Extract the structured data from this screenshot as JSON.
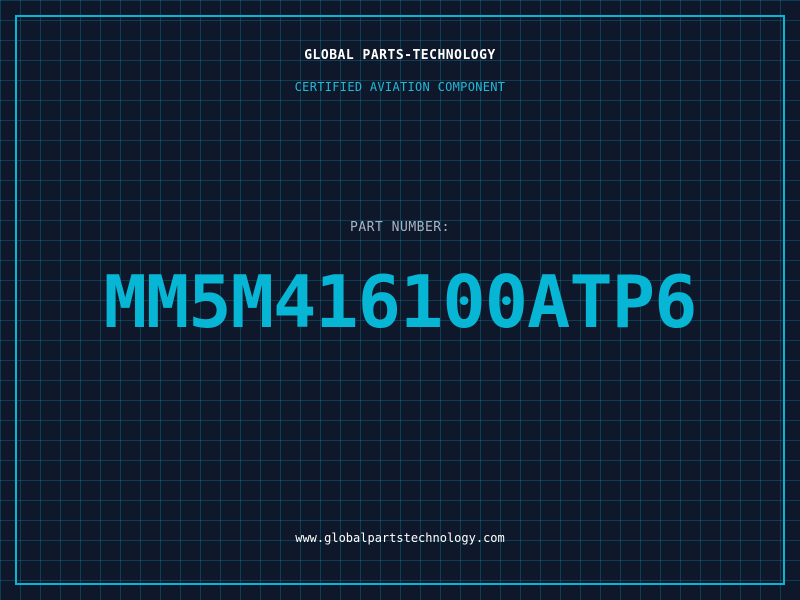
{
  "header": {
    "company": "GLOBAL PARTS-TECHNOLOGY",
    "tagline": "CERTIFIED AVIATION COMPONENT"
  },
  "part": {
    "label": "PART NUMBER:",
    "number": "MM5M416100ATP6"
  },
  "footer": {
    "website": "www.globalpartstechnology.com"
  },
  "colors": {
    "background": "#0f172a",
    "accent": "#06b6d4",
    "grid": "#0e3a4a"
  }
}
